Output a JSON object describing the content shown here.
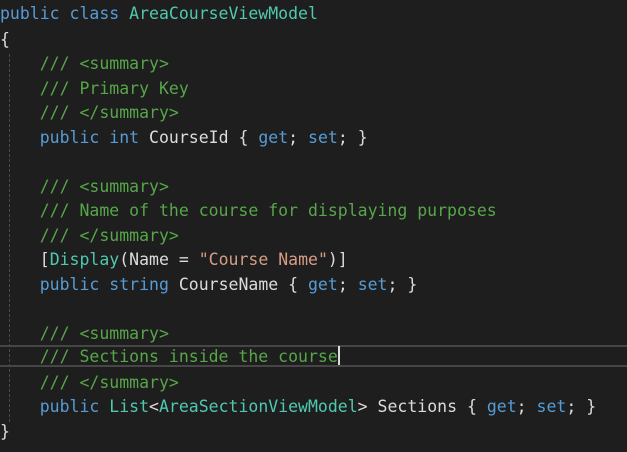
{
  "colors": {
    "background": "#1e1e1e",
    "keyword": "#569cd6",
    "type": "#4ec9b0",
    "comment": "#57a64a",
    "string": "#d69d85",
    "plain": "#dcdcdc"
  },
  "code": {
    "class_keyword_public": "public",
    "class_keyword_class": "class",
    "class_name": "AreaCourseViewModel",
    "open_brace": "{",
    "close_brace": "}",
    "summary_open": "/// <summary>",
    "summary_close": "/// </summary>",
    "doc_primary_key": "/// Primary Key",
    "doc_course_name": "/// Name of the course for displaying purposes",
    "doc_sections": "/// Sections inside the course",
    "kw_public": "public",
    "kw_int": "int",
    "kw_string": "string",
    "prop_course_id": "CourseId",
    "prop_course_name": "CourseName",
    "prop_sections": "Sections",
    "type_list": "List",
    "type_area_section": "AreaSectionViewModel",
    "attr_display": "Display",
    "attr_name_param": "Name",
    "attr_name_value": "\"Course Name\"",
    "accessor_get": "get",
    "accessor_set": "set"
  }
}
